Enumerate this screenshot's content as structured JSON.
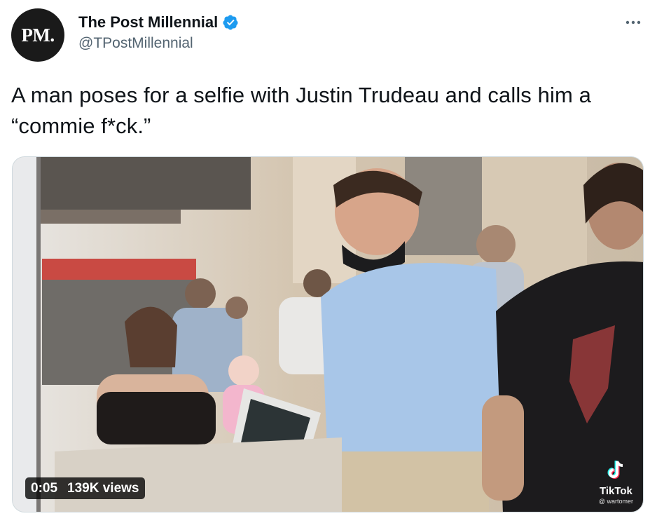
{
  "author": {
    "avatar_text": "PM.",
    "display_name": "The Post Millennial",
    "handle": "@TPostMillennial",
    "verified": true
  },
  "tweet": {
    "text": "A man poses for a selfie with Justin Trudeau and calls him a “commie f*ck.”"
  },
  "media": {
    "duration": "0:05",
    "views": "139K views",
    "watermark": "TikTok",
    "watermark_user": "@ wartomer"
  },
  "icons": {
    "verified": "verified-badge-icon",
    "more": "more-options-icon",
    "tiktok": "tiktok-logo-icon"
  },
  "colors": {
    "verified": "#1d9bf0",
    "handle": "#536471",
    "text": "#0f1419"
  }
}
